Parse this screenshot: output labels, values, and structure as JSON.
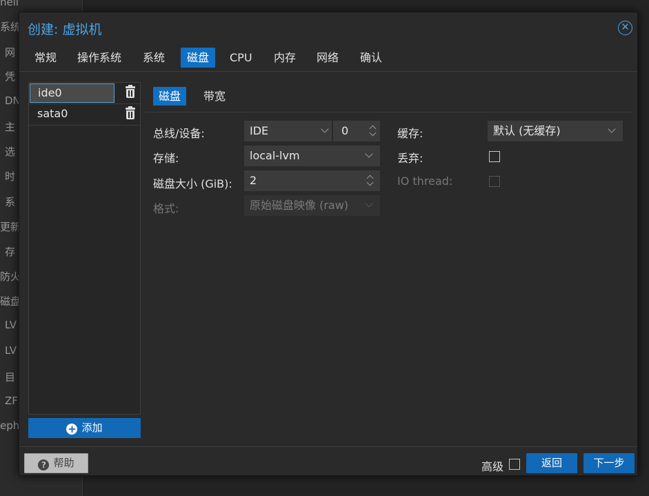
{
  "background": {
    "sidebar_items": [
      "hell",
      "系统",
      "网",
      "凭",
      "DN",
      "主",
      "选",
      "时",
      "系",
      "更新",
      "存",
      "防火墙",
      "磁盘",
      "LV",
      "LV",
      "目",
      "ZF",
      "eph"
    ]
  },
  "modal": {
    "title": "创建: 虚拟机",
    "close_icon": "close-circle-icon",
    "tabs": [
      "常规",
      "操作系统",
      "系统",
      "磁盘",
      "CPU",
      "内存",
      "网络",
      "确认"
    ],
    "active_tab": "磁盘"
  },
  "disk_list": {
    "items": [
      {
        "name": "ide0",
        "selected": true
      },
      {
        "name": "sata0",
        "selected": false
      }
    ],
    "add_label": "添加"
  },
  "subtabs": {
    "items": [
      "磁盘",
      "带宽"
    ],
    "active": "磁盘"
  },
  "form": {
    "bus_label": "总线/设备:",
    "bus_value": "IDE",
    "device_number": "0",
    "storage_label": "存储:",
    "storage_value": "local-lvm",
    "size_label": "磁盘大小 (GiB):",
    "size_value": "2",
    "format_label": "格式:",
    "format_value": "原始磁盘映像 (raw)",
    "cache_label": "缓存:",
    "cache_value": "默认 (无缓存)",
    "discard_label": "丢弃:",
    "discard_checked": false,
    "iothread_label": "IO thread:",
    "iothread_checked": false
  },
  "footer": {
    "help_label": "帮助",
    "advanced_label": "高级",
    "advanced_checked": false,
    "back_label": "返回",
    "next_label": "下一步"
  },
  "colors": {
    "accent": "#1070c4",
    "title": "#4aa3e6",
    "background": "#2a2a2a"
  }
}
